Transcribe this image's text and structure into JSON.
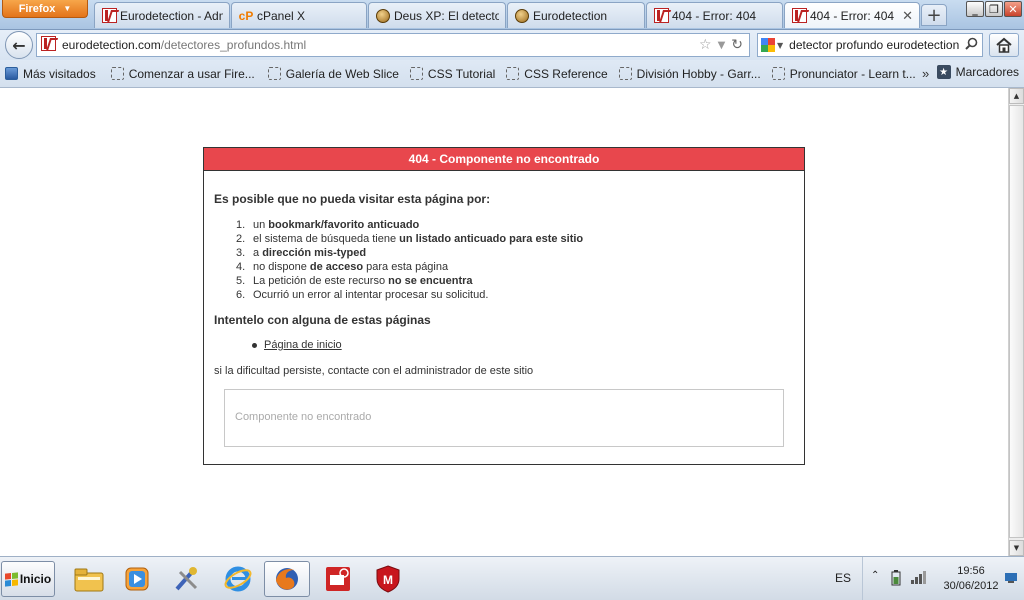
{
  "browser": {
    "menu_label": "Firefox",
    "tabs": [
      {
        "title": "Eurodetection - Admi...",
        "icon": "eurodetection-favicon"
      },
      {
        "title": "cPanel X",
        "icon": "cpanel-favicon"
      },
      {
        "title": "Deus XP: El detector ...",
        "icon": "coin-favicon"
      },
      {
        "title": "Eurodetection",
        "icon": "coin-favicon"
      },
      {
        "title": "404 - Error: 404",
        "icon": "eurodetection-favicon"
      },
      {
        "title": "404 - Error: 404",
        "icon": "eurodetection-favicon",
        "active": true
      }
    ],
    "url_host": "eurodetection.com",
    "url_path": "/detectores_profundos.html",
    "search_value": "detector profundo eurodetection",
    "bookmarks": [
      "Más visitados",
      "Comenzar a usar Fire...",
      "Galería de Web Slice",
      "CSS Tutorial",
      "CSS Reference",
      "División Hobby - Garr...",
      "Pronunciator - Learn t..."
    ],
    "bookmarks_more": "»",
    "bookmarks_menu": "Marcadores"
  },
  "error_page": {
    "header": "404 - Componente no encontrado",
    "intro": "Es posible que no pueda visitar esta página por:",
    "reasons": [
      {
        "num": "1.",
        "pre": "un ",
        "bold": "bookmark/favorito anticuado",
        "post": ""
      },
      {
        "num": "2.",
        "pre": "el sistema de búsqueda tiene ",
        "bold": "un listado anticuado para este sitio",
        "post": ""
      },
      {
        "num": "3.",
        "pre": "a ",
        "bold": "dirección mis-typed",
        "post": ""
      },
      {
        "num": "4.",
        "pre": "no dispone ",
        "bold": "de acceso",
        "post": " para esta página"
      },
      {
        "num": "5.",
        "pre": "La petición de este recurso ",
        "bold": "no se encuentra",
        "post": ""
      },
      {
        "num": "6.",
        "pre": "Ocurrió un error al intentar procesar su solicitud.",
        "bold": "",
        "post": ""
      }
    ],
    "try_heading": "Intentelo con alguna de estas páginas",
    "pages": [
      "Página de inicio"
    ],
    "contact": "si la dificultad persiste, contacte con el administrador de este sitio",
    "info_message": "Componente no encontrado"
  },
  "taskbar": {
    "start_label": "Inicio",
    "apps": [
      "explorer-icon",
      "media-player-icon",
      "tools-icon",
      "internet-explorer-icon",
      "firefox-icon",
      "remote-app-icon",
      "mcafee-icon"
    ],
    "language": "ES",
    "time": "19:56",
    "date": "30/06/2012"
  },
  "colors": {
    "error_header_bg": "#e8474d",
    "firefox_orange": "#e3741a"
  }
}
